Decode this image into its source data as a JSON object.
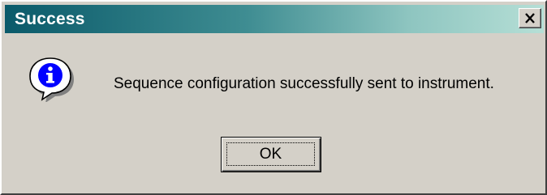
{
  "window": {
    "title": "Success"
  },
  "titlebar": {
    "close_glyph": "×",
    "gradient_start": "#0a5a6a",
    "gradient_end": "#b6dfd6"
  },
  "content": {
    "icon": "info-icon",
    "icon_glyph": "i",
    "message": "Sequence configuration successfully sent to instrument."
  },
  "buttons": {
    "ok_label": "OK"
  },
  "colors": {
    "dialog_background": "#d4d0c8",
    "title_text": "#ffffff",
    "info_icon_accent": "#0000ff"
  }
}
